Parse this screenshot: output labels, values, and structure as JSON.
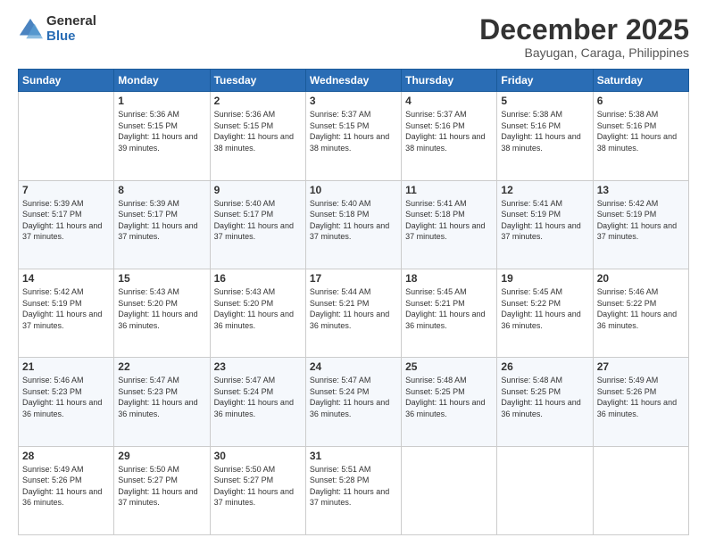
{
  "header": {
    "logo_general": "General",
    "logo_blue": "Blue",
    "month_title": "December 2025",
    "location": "Bayugan, Caraga, Philippines"
  },
  "weekdays": [
    "Sunday",
    "Monday",
    "Tuesday",
    "Wednesday",
    "Thursday",
    "Friday",
    "Saturday"
  ],
  "weeks": [
    [
      {
        "day": "",
        "sunrise": "",
        "sunset": "",
        "daylight": ""
      },
      {
        "day": "1",
        "sunrise": "Sunrise: 5:36 AM",
        "sunset": "Sunset: 5:15 PM",
        "daylight": "Daylight: 11 hours and 39 minutes."
      },
      {
        "day": "2",
        "sunrise": "Sunrise: 5:36 AM",
        "sunset": "Sunset: 5:15 PM",
        "daylight": "Daylight: 11 hours and 38 minutes."
      },
      {
        "day": "3",
        "sunrise": "Sunrise: 5:37 AM",
        "sunset": "Sunset: 5:15 PM",
        "daylight": "Daylight: 11 hours and 38 minutes."
      },
      {
        "day": "4",
        "sunrise": "Sunrise: 5:37 AM",
        "sunset": "Sunset: 5:16 PM",
        "daylight": "Daylight: 11 hours and 38 minutes."
      },
      {
        "day": "5",
        "sunrise": "Sunrise: 5:38 AM",
        "sunset": "Sunset: 5:16 PM",
        "daylight": "Daylight: 11 hours and 38 minutes."
      },
      {
        "day": "6",
        "sunrise": "Sunrise: 5:38 AM",
        "sunset": "Sunset: 5:16 PM",
        "daylight": "Daylight: 11 hours and 38 minutes."
      }
    ],
    [
      {
        "day": "7",
        "sunrise": "Sunrise: 5:39 AM",
        "sunset": "Sunset: 5:17 PM",
        "daylight": "Daylight: 11 hours and 37 minutes."
      },
      {
        "day": "8",
        "sunrise": "Sunrise: 5:39 AM",
        "sunset": "Sunset: 5:17 PM",
        "daylight": "Daylight: 11 hours and 37 minutes."
      },
      {
        "day": "9",
        "sunrise": "Sunrise: 5:40 AM",
        "sunset": "Sunset: 5:17 PM",
        "daylight": "Daylight: 11 hours and 37 minutes."
      },
      {
        "day": "10",
        "sunrise": "Sunrise: 5:40 AM",
        "sunset": "Sunset: 5:18 PM",
        "daylight": "Daylight: 11 hours and 37 minutes."
      },
      {
        "day": "11",
        "sunrise": "Sunrise: 5:41 AM",
        "sunset": "Sunset: 5:18 PM",
        "daylight": "Daylight: 11 hours and 37 minutes."
      },
      {
        "day": "12",
        "sunrise": "Sunrise: 5:41 AM",
        "sunset": "Sunset: 5:19 PM",
        "daylight": "Daylight: 11 hours and 37 minutes."
      },
      {
        "day": "13",
        "sunrise": "Sunrise: 5:42 AM",
        "sunset": "Sunset: 5:19 PM",
        "daylight": "Daylight: 11 hours and 37 minutes."
      }
    ],
    [
      {
        "day": "14",
        "sunrise": "Sunrise: 5:42 AM",
        "sunset": "Sunset: 5:19 PM",
        "daylight": "Daylight: 11 hours and 37 minutes."
      },
      {
        "day": "15",
        "sunrise": "Sunrise: 5:43 AM",
        "sunset": "Sunset: 5:20 PM",
        "daylight": "Daylight: 11 hours and 36 minutes."
      },
      {
        "day": "16",
        "sunrise": "Sunrise: 5:43 AM",
        "sunset": "Sunset: 5:20 PM",
        "daylight": "Daylight: 11 hours and 36 minutes."
      },
      {
        "day": "17",
        "sunrise": "Sunrise: 5:44 AM",
        "sunset": "Sunset: 5:21 PM",
        "daylight": "Daylight: 11 hours and 36 minutes."
      },
      {
        "day": "18",
        "sunrise": "Sunrise: 5:45 AM",
        "sunset": "Sunset: 5:21 PM",
        "daylight": "Daylight: 11 hours and 36 minutes."
      },
      {
        "day": "19",
        "sunrise": "Sunrise: 5:45 AM",
        "sunset": "Sunset: 5:22 PM",
        "daylight": "Daylight: 11 hours and 36 minutes."
      },
      {
        "day": "20",
        "sunrise": "Sunrise: 5:46 AM",
        "sunset": "Sunset: 5:22 PM",
        "daylight": "Daylight: 11 hours and 36 minutes."
      }
    ],
    [
      {
        "day": "21",
        "sunrise": "Sunrise: 5:46 AM",
        "sunset": "Sunset: 5:23 PM",
        "daylight": "Daylight: 11 hours and 36 minutes."
      },
      {
        "day": "22",
        "sunrise": "Sunrise: 5:47 AM",
        "sunset": "Sunset: 5:23 PM",
        "daylight": "Daylight: 11 hours and 36 minutes."
      },
      {
        "day": "23",
        "sunrise": "Sunrise: 5:47 AM",
        "sunset": "Sunset: 5:24 PM",
        "daylight": "Daylight: 11 hours and 36 minutes."
      },
      {
        "day": "24",
        "sunrise": "Sunrise: 5:47 AM",
        "sunset": "Sunset: 5:24 PM",
        "daylight": "Daylight: 11 hours and 36 minutes."
      },
      {
        "day": "25",
        "sunrise": "Sunrise: 5:48 AM",
        "sunset": "Sunset: 5:25 PM",
        "daylight": "Daylight: 11 hours and 36 minutes."
      },
      {
        "day": "26",
        "sunrise": "Sunrise: 5:48 AM",
        "sunset": "Sunset: 5:25 PM",
        "daylight": "Daylight: 11 hours and 36 minutes."
      },
      {
        "day": "27",
        "sunrise": "Sunrise: 5:49 AM",
        "sunset": "Sunset: 5:26 PM",
        "daylight": "Daylight: 11 hours and 36 minutes."
      }
    ],
    [
      {
        "day": "28",
        "sunrise": "Sunrise: 5:49 AM",
        "sunset": "Sunset: 5:26 PM",
        "daylight": "Daylight: 11 hours and 36 minutes."
      },
      {
        "day": "29",
        "sunrise": "Sunrise: 5:50 AM",
        "sunset": "Sunset: 5:27 PM",
        "daylight": "Daylight: 11 hours and 37 minutes."
      },
      {
        "day": "30",
        "sunrise": "Sunrise: 5:50 AM",
        "sunset": "Sunset: 5:27 PM",
        "daylight": "Daylight: 11 hours and 37 minutes."
      },
      {
        "day": "31",
        "sunrise": "Sunrise: 5:51 AM",
        "sunset": "Sunset: 5:28 PM",
        "daylight": "Daylight: 11 hours and 37 minutes."
      },
      {
        "day": "",
        "sunrise": "",
        "sunset": "",
        "daylight": ""
      },
      {
        "day": "",
        "sunrise": "",
        "sunset": "",
        "daylight": ""
      },
      {
        "day": "",
        "sunrise": "",
        "sunset": "",
        "daylight": ""
      }
    ]
  ]
}
